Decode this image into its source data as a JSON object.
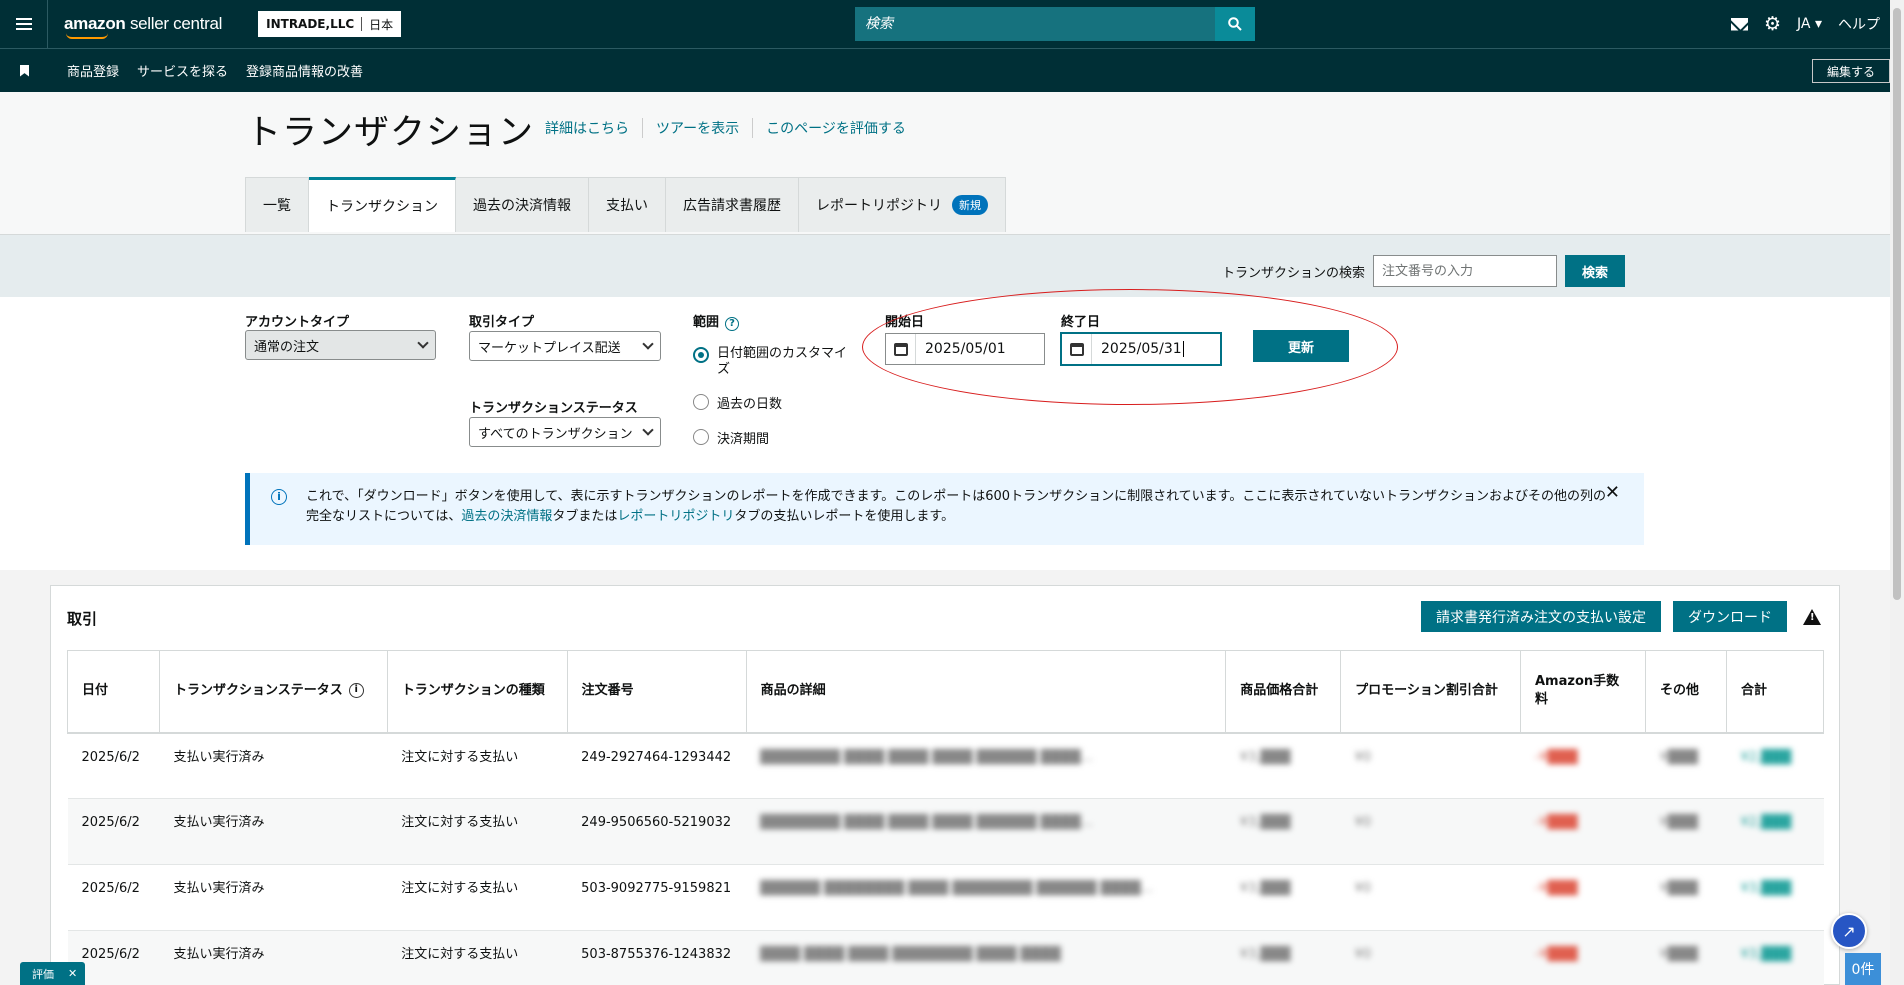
{
  "topbar": {
    "logo_main": "amazon",
    "logo_sub": "seller central",
    "account_name": "INTRADE,LLC",
    "marketplace": "日本",
    "search_placeholder": "検索",
    "language": "JA",
    "help": "ヘルプ"
  },
  "subnav": {
    "links": [
      "商品登録",
      "サービスを探る",
      "登録商品情報の改善"
    ],
    "edit_label": "編集する"
  },
  "header": {
    "title": "トランザクション",
    "links": [
      "詳細はこちら",
      "ツアーを表示",
      "このページを評価する"
    ]
  },
  "tabs": [
    {
      "label": "一覧"
    },
    {
      "label": "トランザクション"
    },
    {
      "label": "過去の決済情報"
    },
    {
      "label": "支払い"
    },
    {
      "label": "広告請求書履歴"
    },
    {
      "label": "レポートリポジトリ",
      "badge": "新規"
    }
  ],
  "tx_search": {
    "label": "トランザクションの検索",
    "placeholder": "注文番号の入力",
    "button": "検索"
  },
  "filters": {
    "account_type_label": "アカウントタイプ",
    "account_type_value": "通常の注文",
    "tx_type_label": "取引タイプ",
    "tx_type_value": "マーケットプレイス配送",
    "tx_status_label": "トランザクションステータス",
    "tx_status_value": "すべてのトランザクション",
    "range_label": "範囲",
    "range_options": [
      "日付範囲のカスタマイズ",
      "過去の日数",
      "決済期間"
    ],
    "start_label": "開始日",
    "start_value": "2025/05/01",
    "end_label": "終了日",
    "end_value": "2025/05/31",
    "update_button": "更新"
  },
  "info": {
    "text1": "これで、「ダウンロード」ボタンを使用して、表に示すトランザクションのレポートを作成できます。このレポートは600トランザクションに制限されています。ここに表示されていないトランザクションおよびその他の列の完全なリストについては、",
    "link1": "過去の決済情報",
    "text2": "タブまたは",
    "link2": "レポートリポジトリ",
    "text3": "タブの支払いレポートを使用します。"
  },
  "panel": {
    "title": "取引",
    "invoice_button": "請求書発行済み注文の支払い設定",
    "download_button": "ダウンロード"
  },
  "table": {
    "headers": [
      "日付",
      "トランザクションステータス",
      "トランザクションの種類",
      "注文番号",
      "商品の詳細",
      "商品価格合計",
      "プロモーション割引合計",
      "Amazon手数料",
      "その他",
      "合計"
    ],
    "rows": [
      {
        "date": "2025/6/2",
        "status": "支払い実行済み",
        "type": "注文に対する支払い",
        "order": "249-2927464-1293442",
        "detail": "████████ ████ ████ ████ ██████ ████...",
        "price": "¥3,███",
        "promo": "¥0",
        "fee": "-¥███",
        "other": "¥███",
        "total": "¥2,███"
      },
      {
        "date": "2025/6/2",
        "status": "支払い実行済み",
        "type": "注文に対する支払い",
        "order": "249-9506560-5219032",
        "detail": "████████ ████ ████ ████ ██████ ████...",
        "price": "¥3,███",
        "promo": "¥0",
        "fee": "-¥███",
        "other": "¥███",
        "total": "¥2,███"
      },
      {
        "date": "2025/6/2",
        "status": "支払い実行済み",
        "type": "注文に対する支払い",
        "order": "503-9092775-9159821",
        "detail": "██████ ████████ ████ ████████ ██████ ████...",
        "price": "¥3,███",
        "promo": "¥0",
        "fee": "-¥███",
        "other": "¥███",
        "total": "¥3,███"
      },
      {
        "date": "2025/6/2",
        "status": "支払い実行済み",
        "type": "注文に対する支払い",
        "order": "503-8755376-1243832",
        "detail": "████ ████ ████ ████████ ████ ████",
        "price": "¥3,███",
        "promo": "¥0",
        "fee": "-¥███",
        "other": "¥███",
        "total": "¥3,███"
      }
    ]
  },
  "footer": {
    "rate_label": "評価",
    "count_label": "0件"
  }
}
